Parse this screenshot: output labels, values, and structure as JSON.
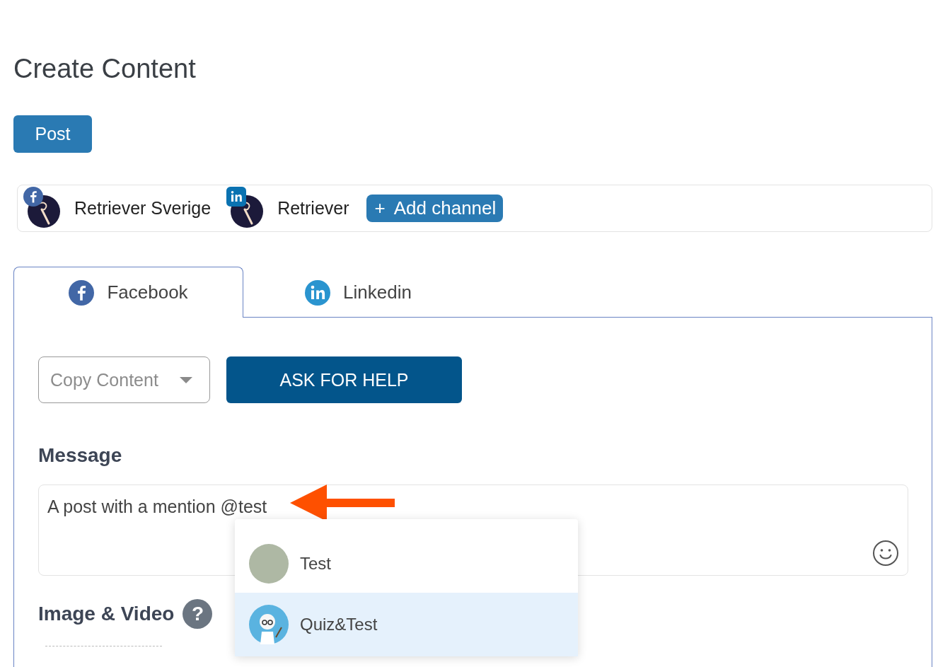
{
  "page": {
    "title": "Create Content"
  },
  "post_button": "Post",
  "channels": [
    {
      "name": "Retriever Sverige",
      "kind": "facebook"
    },
    {
      "name": "Retriever",
      "kind": "linkedin"
    }
  ],
  "add_channel": {
    "icon": "+",
    "label": "Add channel"
  },
  "tabs": [
    {
      "label": "Facebook",
      "kind": "facebook",
      "selected": true
    },
    {
      "label": "Linkedin",
      "kind": "linkedin",
      "selected": false
    }
  ],
  "copy_content": {
    "placeholder": "Copy Content"
  },
  "help_button": "ASK FOR HELP",
  "message": {
    "label": "Message",
    "value": "A post with a mention @test"
  },
  "mention_suggestions": [
    {
      "name": "Test",
      "kind": "group-photo",
      "selected": false
    },
    {
      "name": "Quiz&Test",
      "kind": "cartoon",
      "selected": true
    }
  ],
  "media": {
    "label": "Image & Video",
    "help": "?"
  }
}
